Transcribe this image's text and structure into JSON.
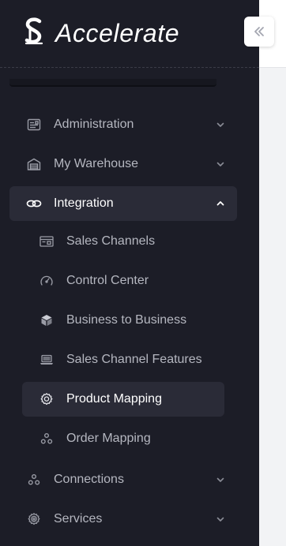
{
  "brand": {
    "name": "Accelerate"
  },
  "collapse_button": {
    "icon": "chevrons-left-icon"
  },
  "nav": {
    "items": [
      {
        "label": "Administration",
        "icon": "admin-panel-icon",
        "expanded": false
      },
      {
        "label": "My Warehouse",
        "icon": "warehouse-icon",
        "expanded": false
      },
      {
        "label": "Integration",
        "icon": "integration-link-icon",
        "expanded": true
      },
      {
        "label": "Connections",
        "icon": "connections-icon",
        "expanded": false
      },
      {
        "label": "Services",
        "icon": "services-gear-icon",
        "expanded": false
      }
    ],
    "integration_children": [
      {
        "label": "Sales Channels",
        "icon": "sales-channels-icon"
      },
      {
        "label": "Control Center",
        "icon": "speedometer-icon"
      },
      {
        "label": "Business to Business",
        "icon": "box-icon"
      },
      {
        "label": "Sales Channel Features",
        "icon": "laptop-icon"
      },
      {
        "label": "Product Mapping",
        "icon": "gear-icon",
        "selected": true
      },
      {
        "label": "Order Mapping",
        "icon": "mapping-nodes-icon"
      }
    ]
  },
  "colors": {
    "sidebar_bg": "#1c1d27",
    "active_bg": "#2a2b37",
    "text_muted": "#b5b7c0",
    "text_active": "#ffffff"
  }
}
